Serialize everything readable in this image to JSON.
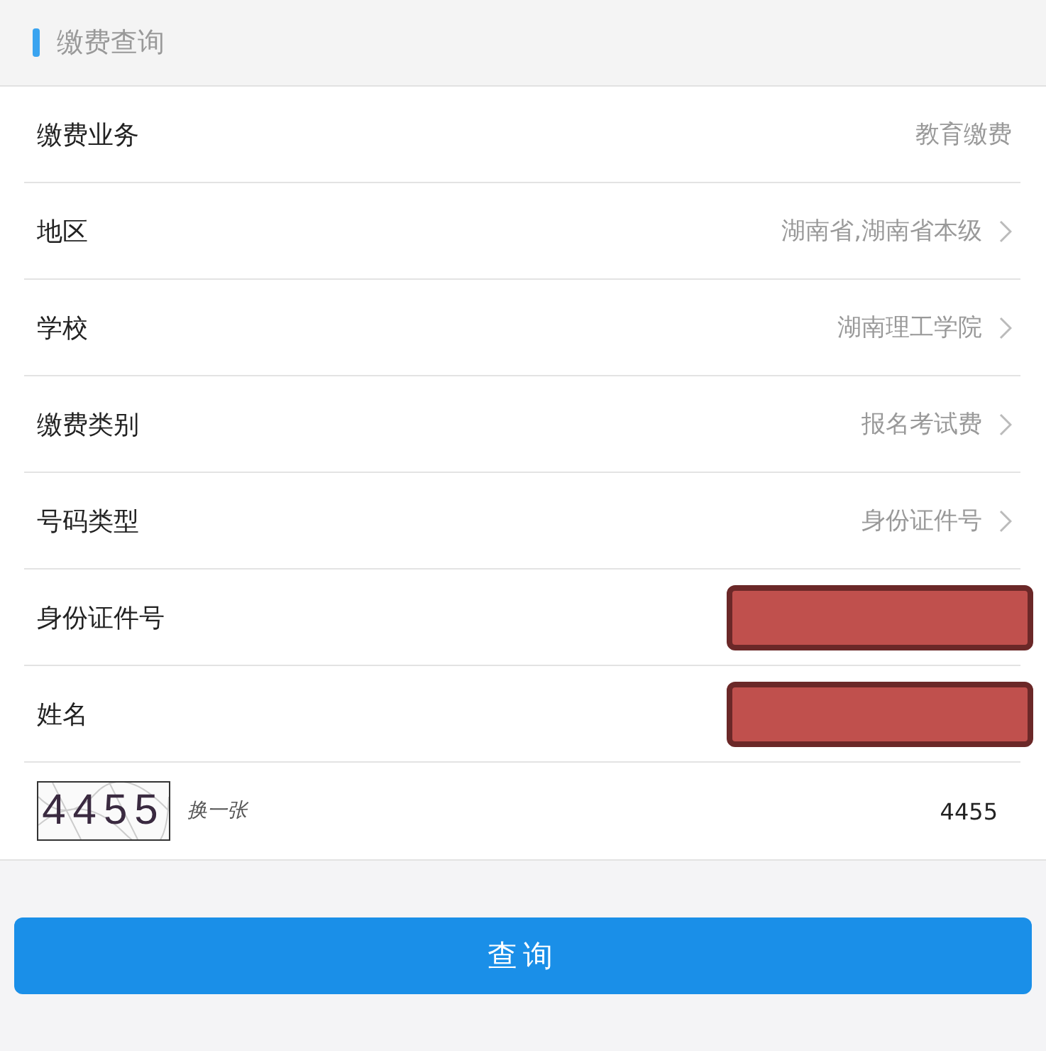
{
  "header": {
    "title": "缴费查询"
  },
  "rows": [
    {
      "kind": "static",
      "label": "缴费业务",
      "value": "教育缴费"
    },
    {
      "kind": "select",
      "label": "地区",
      "value": "湖南省,湖南省本级"
    },
    {
      "kind": "select",
      "label": "学校",
      "value": "湖南理工学院"
    },
    {
      "kind": "select",
      "label": "缴费类别",
      "value": "报名考试费"
    },
    {
      "kind": "select",
      "label": "号码类型",
      "value": "身份证件号"
    },
    {
      "kind": "redacted",
      "label": "身份证件号"
    },
    {
      "kind": "redacted",
      "label": "姓名"
    }
  ],
  "captcha": {
    "image_text": "4455",
    "refresh_link": "换一张",
    "value": "4455"
  },
  "submit_button": "查询"
}
